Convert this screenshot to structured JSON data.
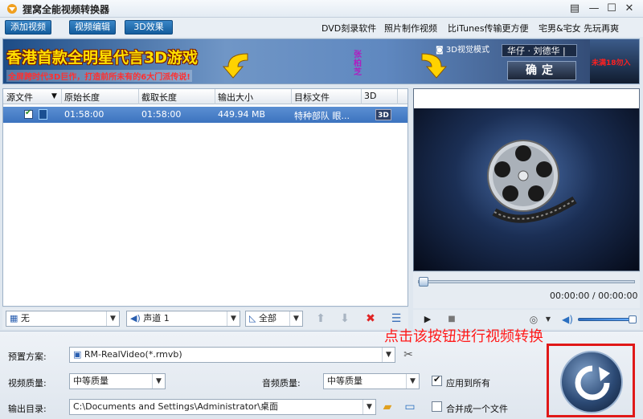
{
  "window": {
    "title": "狸窝全能视频转换器",
    "menu_icon": "▤",
    "minimize": "—",
    "maximize": "☐",
    "close": "✕"
  },
  "toolbar": {
    "add_video": "添加视频",
    "edit_video": "视频编辑",
    "effect_3d": "3D效果",
    "links": [
      "DVD刻录软件",
      "照片制作视频",
      "比iTunes传输更方便",
      "宅男&宅女 先玩再爽"
    ]
  },
  "banner": {
    "headline": "香港首款全明星代言3D游戏",
    "subline": "全屏跨时代3D巨作，打造前所未有的6大门派传说!",
    "vertical_text": "张柏芝",
    "mode_label": "3D视觉模式",
    "star_select": "华仔 · 刘德华 |",
    "confirm": "确定",
    "side_text": "未满18勿入"
  },
  "file_list": {
    "columns": [
      "源文件",
      "原始长度",
      "截取长度",
      "输出大小",
      "目标文件",
      "3D"
    ],
    "rows": [
      {
        "original": "01:58:00",
        "clip": "01:58:00",
        "size": "449.94 MB",
        "target": "特种部队 眼...",
        "badge": "3D"
      }
    ]
  },
  "list_controls": {
    "subtitle": "无",
    "audio_track": "声道 1",
    "range": "全部"
  },
  "preview": {
    "time": "00:00:00 / 00:00:00"
  },
  "settings": {
    "preset_label": "预置方案:",
    "preset_value": "RM-RealVideo(*.rmvb)",
    "video_quality_label": "视频质量:",
    "video_quality_value": "中等质量",
    "audio_quality_label": "音频质量:",
    "audio_quality_value": "中等质量",
    "apply_all": "应用到所有",
    "output_label": "输出目录:",
    "output_path": "C:\\Documents and Settings\\Administrator\\桌面",
    "merge": "合并成一个文件"
  },
  "annotation": "点击该按钮进行视频转换"
}
